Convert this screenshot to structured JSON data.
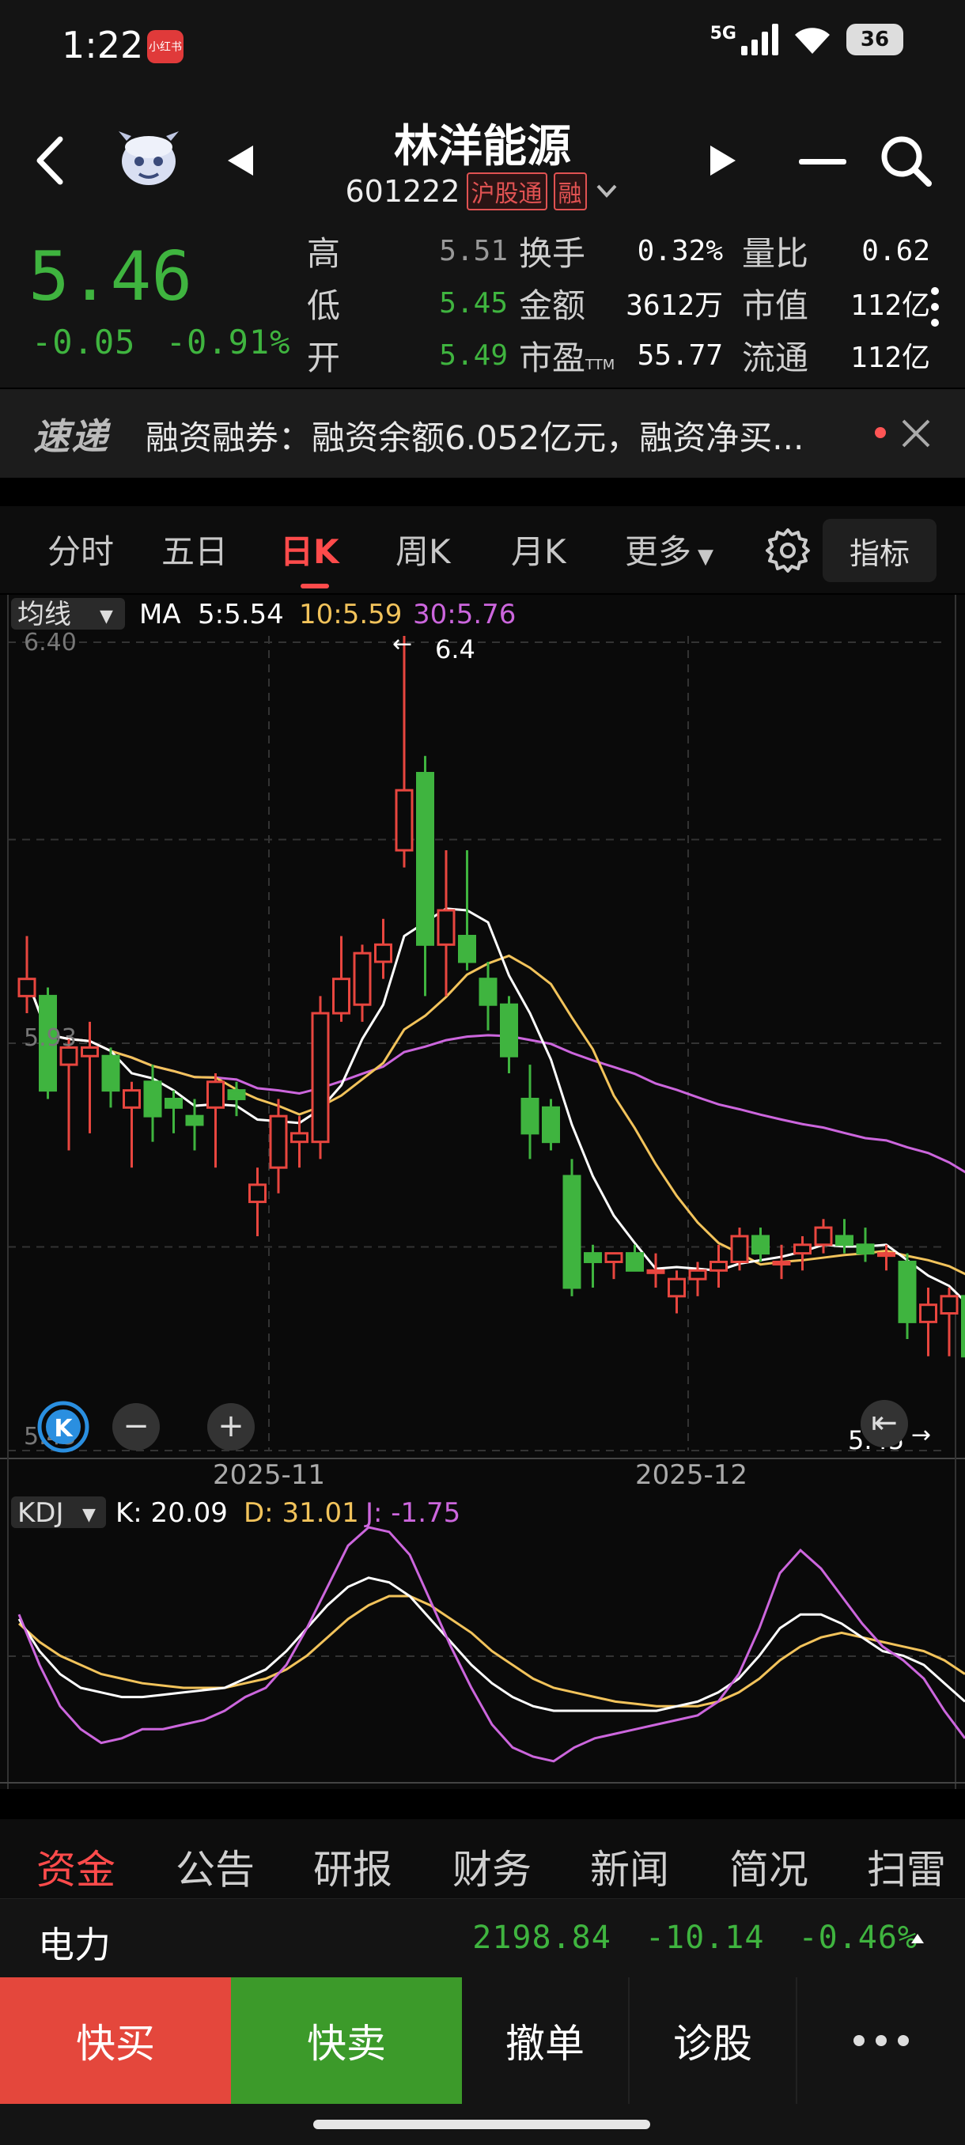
{
  "status_bar": {
    "time": "1:22",
    "app_badge": "小红书",
    "network": "5G",
    "battery": "36"
  },
  "header": {
    "stock_name": "林洋能源",
    "stock_code": "601222",
    "tag_connect": "沪股通",
    "tag_margin": "融"
  },
  "quote": {
    "price": "5.46",
    "change": "-0.05",
    "change_pct": "-0.91%",
    "rows": [
      {
        "l1": "高",
        "v1": "5.51",
        "l2": "换手",
        "v2": "0.32%",
        "l3": "量比",
        "v3": "0.62"
      },
      {
        "l1": "低",
        "v1": "5.45",
        "l2": "金额",
        "v2": "3612万",
        "l3": "市值",
        "v3": "112亿"
      },
      {
        "l1": "开",
        "v1": "5.49",
        "l2": "市盈",
        "l2_sup": "TTM",
        "v2": "55.77",
        "l3": "流通",
        "v3": "112亿"
      }
    ]
  },
  "news": {
    "logo": "速递",
    "text": "融资融券：融资余额6.052亿元，融资净买..."
  },
  "period_tabs": [
    "分时",
    "五日",
    "日K",
    "周K",
    "月K",
    "更多"
  ],
  "indicator_label": "指标",
  "main_chart": {
    "selector": "均线",
    "ma_label": "MA",
    "ma5": "5:5.54",
    "ma10": "10:5.59",
    "ma30": "30:5.76",
    "y_top": "6.40",
    "y_mid": "5.93",
    "y_bottom": "5.45",
    "high_marker": "6.4",
    "low_marker": "5.45",
    "x_labels": [
      "2025-11",
      "2025-12"
    ]
  },
  "kdj_chart": {
    "selector": "KDJ",
    "k": "K: 20.09",
    "d": "D: 31.01",
    "j": "J: -1.75"
  },
  "info_tabs": [
    "资金",
    "公告",
    "研报",
    "财务",
    "新闻",
    "简况",
    "扫雷"
  ],
  "sector": {
    "name": "电力",
    "index": "2198.84",
    "change": "-10.14",
    "change_pct": "-0.46%"
  },
  "actions": {
    "buy": "快买",
    "sell": "快卖",
    "cancel": "撤单",
    "diagnose": "诊股"
  },
  "colors": {
    "up": "#e8463f",
    "down": "#3fb43f",
    "ma5": "#ffffff",
    "ma10": "#f2c35b",
    "ma30": "#cc66dd",
    "buy_bg": "#e4473c",
    "sell_bg": "#3c9a2a"
  },
  "chart_data": {
    "type": "candlestick",
    "y_range": [
      5.45,
      6.4
    ],
    "candles": [
      {
        "o": 5.98,
        "h": 6.05,
        "l": 5.96,
        "c": 6.0
      },
      {
        "o": 5.98,
        "h": 5.99,
        "l": 5.86,
        "c": 5.87
      },
      {
        "o": 5.9,
        "h": 5.93,
        "l": 5.8,
        "c": 5.92
      },
      {
        "o": 5.91,
        "h": 5.95,
        "l": 5.82,
        "c": 5.92
      },
      {
        "o": 5.91,
        "h": 5.92,
        "l": 5.85,
        "c": 5.87
      },
      {
        "o": 5.85,
        "h": 5.88,
        "l": 5.78,
        "c": 5.87
      },
      {
        "o": 5.88,
        "h": 5.9,
        "l": 5.81,
        "c": 5.84
      },
      {
        "o": 5.86,
        "h": 5.87,
        "l": 5.82,
        "c": 5.85
      },
      {
        "o": 5.84,
        "h": 5.86,
        "l": 5.8,
        "c": 5.83
      },
      {
        "o": 5.85,
        "h": 5.89,
        "l": 5.78,
        "c": 5.88
      },
      {
        "o": 5.87,
        "h": 5.88,
        "l": 5.84,
        "c": 5.86
      },
      {
        "o": 5.74,
        "h": 5.78,
        "l": 5.7,
        "c": 5.76
      },
      {
        "o": 5.78,
        "h": 5.86,
        "l": 5.75,
        "c": 5.84
      },
      {
        "o": 5.81,
        "h": 5.84,
        "l": 5.78,
        "c": 5.82
      },
      {
        "o": 5.81,
        "h": 5.98,
        "l": 5.79,
        "c": 5.96
      },
      {
        "o": 5.96,
        "h": 6.05,
        "l": 5.95,
        "c": 6.0
      },
      {
        "o": 5.97,
        "h": 6.04,
        "l": 5.95,
        "c": 6.03
      },
      {
        "o": 6.02,
        "h": 6.07,
        "l": 6.0,
        "c": 6.04
      },
      {
        "o": 6.15,
        "h": 6.4,
        "l": 6.13,
        "c": 6.22
      },
      {
        "o": 6.24,
        "h": 6.26,
        "l": 5.98,
        "c": 6.04
      },
      {
        "o": 6.04,
        "h": 6.15,
        "l": 5.98,
        "c": 6.08
      },
      {
        "o": 6.05,
        "h": 6.15,
        "l": 6.01,
        "c": 6.02
      },
      {
        "o": 6.0,
        "h": 6.02,
        "l": 5.94,
        "c": 5.97
      },
      {
        "o": 5.97,
        "h": 5.98,
        "l": 5.89,
        "c": 5.91
      },
      {
        "o": 5.86,
        "h": 5.9,
        "l": 5.79,
        "c": 5.82
      },
      {
        "o": 5.85,
        "h": 5.86,
        "l": 5.8,
        "c": 5.81
      },
      {
        "o": 5.77,
        "h": 5.79,
        "l": 5.63,
        "c": 5.64
      },
      {
        "o": 5.68,
        "h": 5.69,
        "l": 5.64,
        "c": 5.67
      },
      {
        "o": 5.67,
        "h": 5.68,
        "l": 5.65,
        "c": 5.68
      },
      {
        "o": 5.68,
        "h": 5.69,
        "l": 5.66,
        "c": 5.66
      },
      {
        "o": 5.66,
        "h": 5.68,
        "l": 5.64,
        "c": 5.66
      },
      {
        "o": 5.63,
        "h": 5.66,
        "l": 5.61,
        "c": 5.65
      },
      {
        "o": 5.65,
        "h": 5.67,
        "l": 5.63,
        "c": 5.66
      },
      {
        "o": 5.66,
        "h": 5.69,
        "l": 5.64,
        "c": 5.67
      },
      {
        "o": 5.67,
        "h": 5.71,
        "l": 5.66,
        "c": 5.7
      },
      {
        "o": 5.7,
        "h": 5.71,
        "l": 5.67,
        "c": 5.68
      },
      {
        "o": 5.67,
        "h": 5.69,
        "l": 5.65,
        "c": 5.67
      },
      {
        "o": 5.68,
        "h": 5.7,
        "l": 5.66,
        "c": 5.69
      },
      {
        "o": 5.69,
        "h": 5.72,
        "l": 5.68,
        "c": 5.71
      },
      {
        "o": 5.7,
        "h": 5.72,
        "l": 5.68,
        "c": 5.69
      },
      {
        "o": 5.69,
        "h": 5.71,
        "l": 5.67,
        "c": 5.68
      },
      {
        "o": 5.68,
        "h": 5.69,
        "l": 5.66,
        "c": 5.68
      },
      {
        "o": 5.67,
        "h": 5.68,
        "l": 5.58,
        "c": 5.6
      },
      {
        "o": 5.6,
        "h": 5.64,
        "l": 5.56,
        "c": 5.62
      },
      {
        "o": 5.61,
        "h": 5.64,
        "l": 5.56,
        "c": 5.63
      },
      {
        "o": 5.63,
        "h": 5.64,
        "l": 5.55,
        "c": 5.56
      },
      {
        "o": 5.52,
        "h": 5.53,
        "l": 5.45,
        "c": 5.49
      }
    ]
  }
}
